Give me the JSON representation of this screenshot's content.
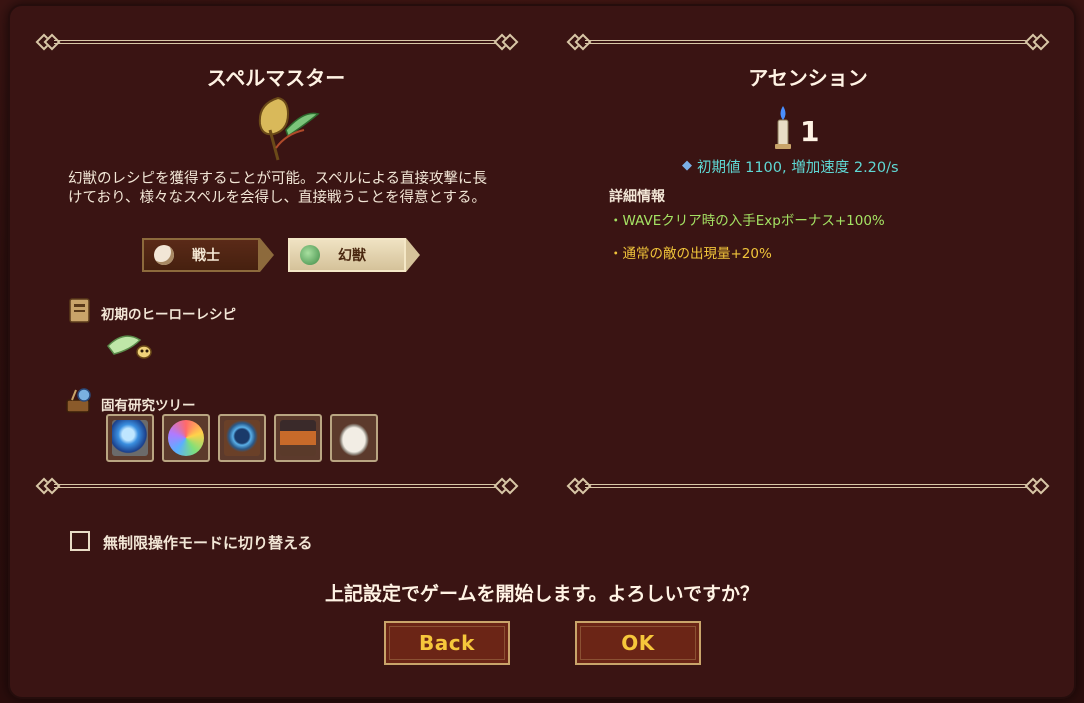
{
  "left_panel": {
    "class_title": "スペルマスター",
    "description": "幻獣のレシピを獲得することが可能。スペルによる直接攻撃に長けており、様々なスペルを会得し、直接戦うことを得意とする。",
    "tags": [
      {
        "label": "戦士",
        "selected": false
      },
      {
        "label": "幻獣",
        "selected": true
      }
    ],
    "hero_recipe_label": "初期のヒーローレシピ",
    "research_tree_label": "固有研究ツリー",
    "research_icons": [
      "blue-orb-icon",
      "rainbow-orb-icon",
      "spider-icon",
      "furnace-icon",
      "jar-icon"
    ]
  },
  "right_panel": {
    "title": "アセンション",
    "candle_count": "1",
    "initial_value": "初期値 1100, 増加速度 2.20/s",
    "detail_title": "詳細情報",
    "bonuses": [
      {
        "text": "・WAVEクリア時の入手Expボーナス+100%",
        "color": "#a4e263"
      },
      {
        "text": "・通常の敵の出現量+20%",
        "color": "#f0c43a"
      }
    ]
  },
  "unlimited_mode_label": "無制限操作モードに切り替える",
  "unlimited_mode_checked": false,
  "confirm_text": "上記設定でゲームを開始します。よろしいですか？",
  "buttons": {
    "back": "Back",
    "ok": "OK"
  },
  "colors": {
    "button_text": "#f6c73b",
    "accent_cyan": "#5fd8d4"
  }
}
